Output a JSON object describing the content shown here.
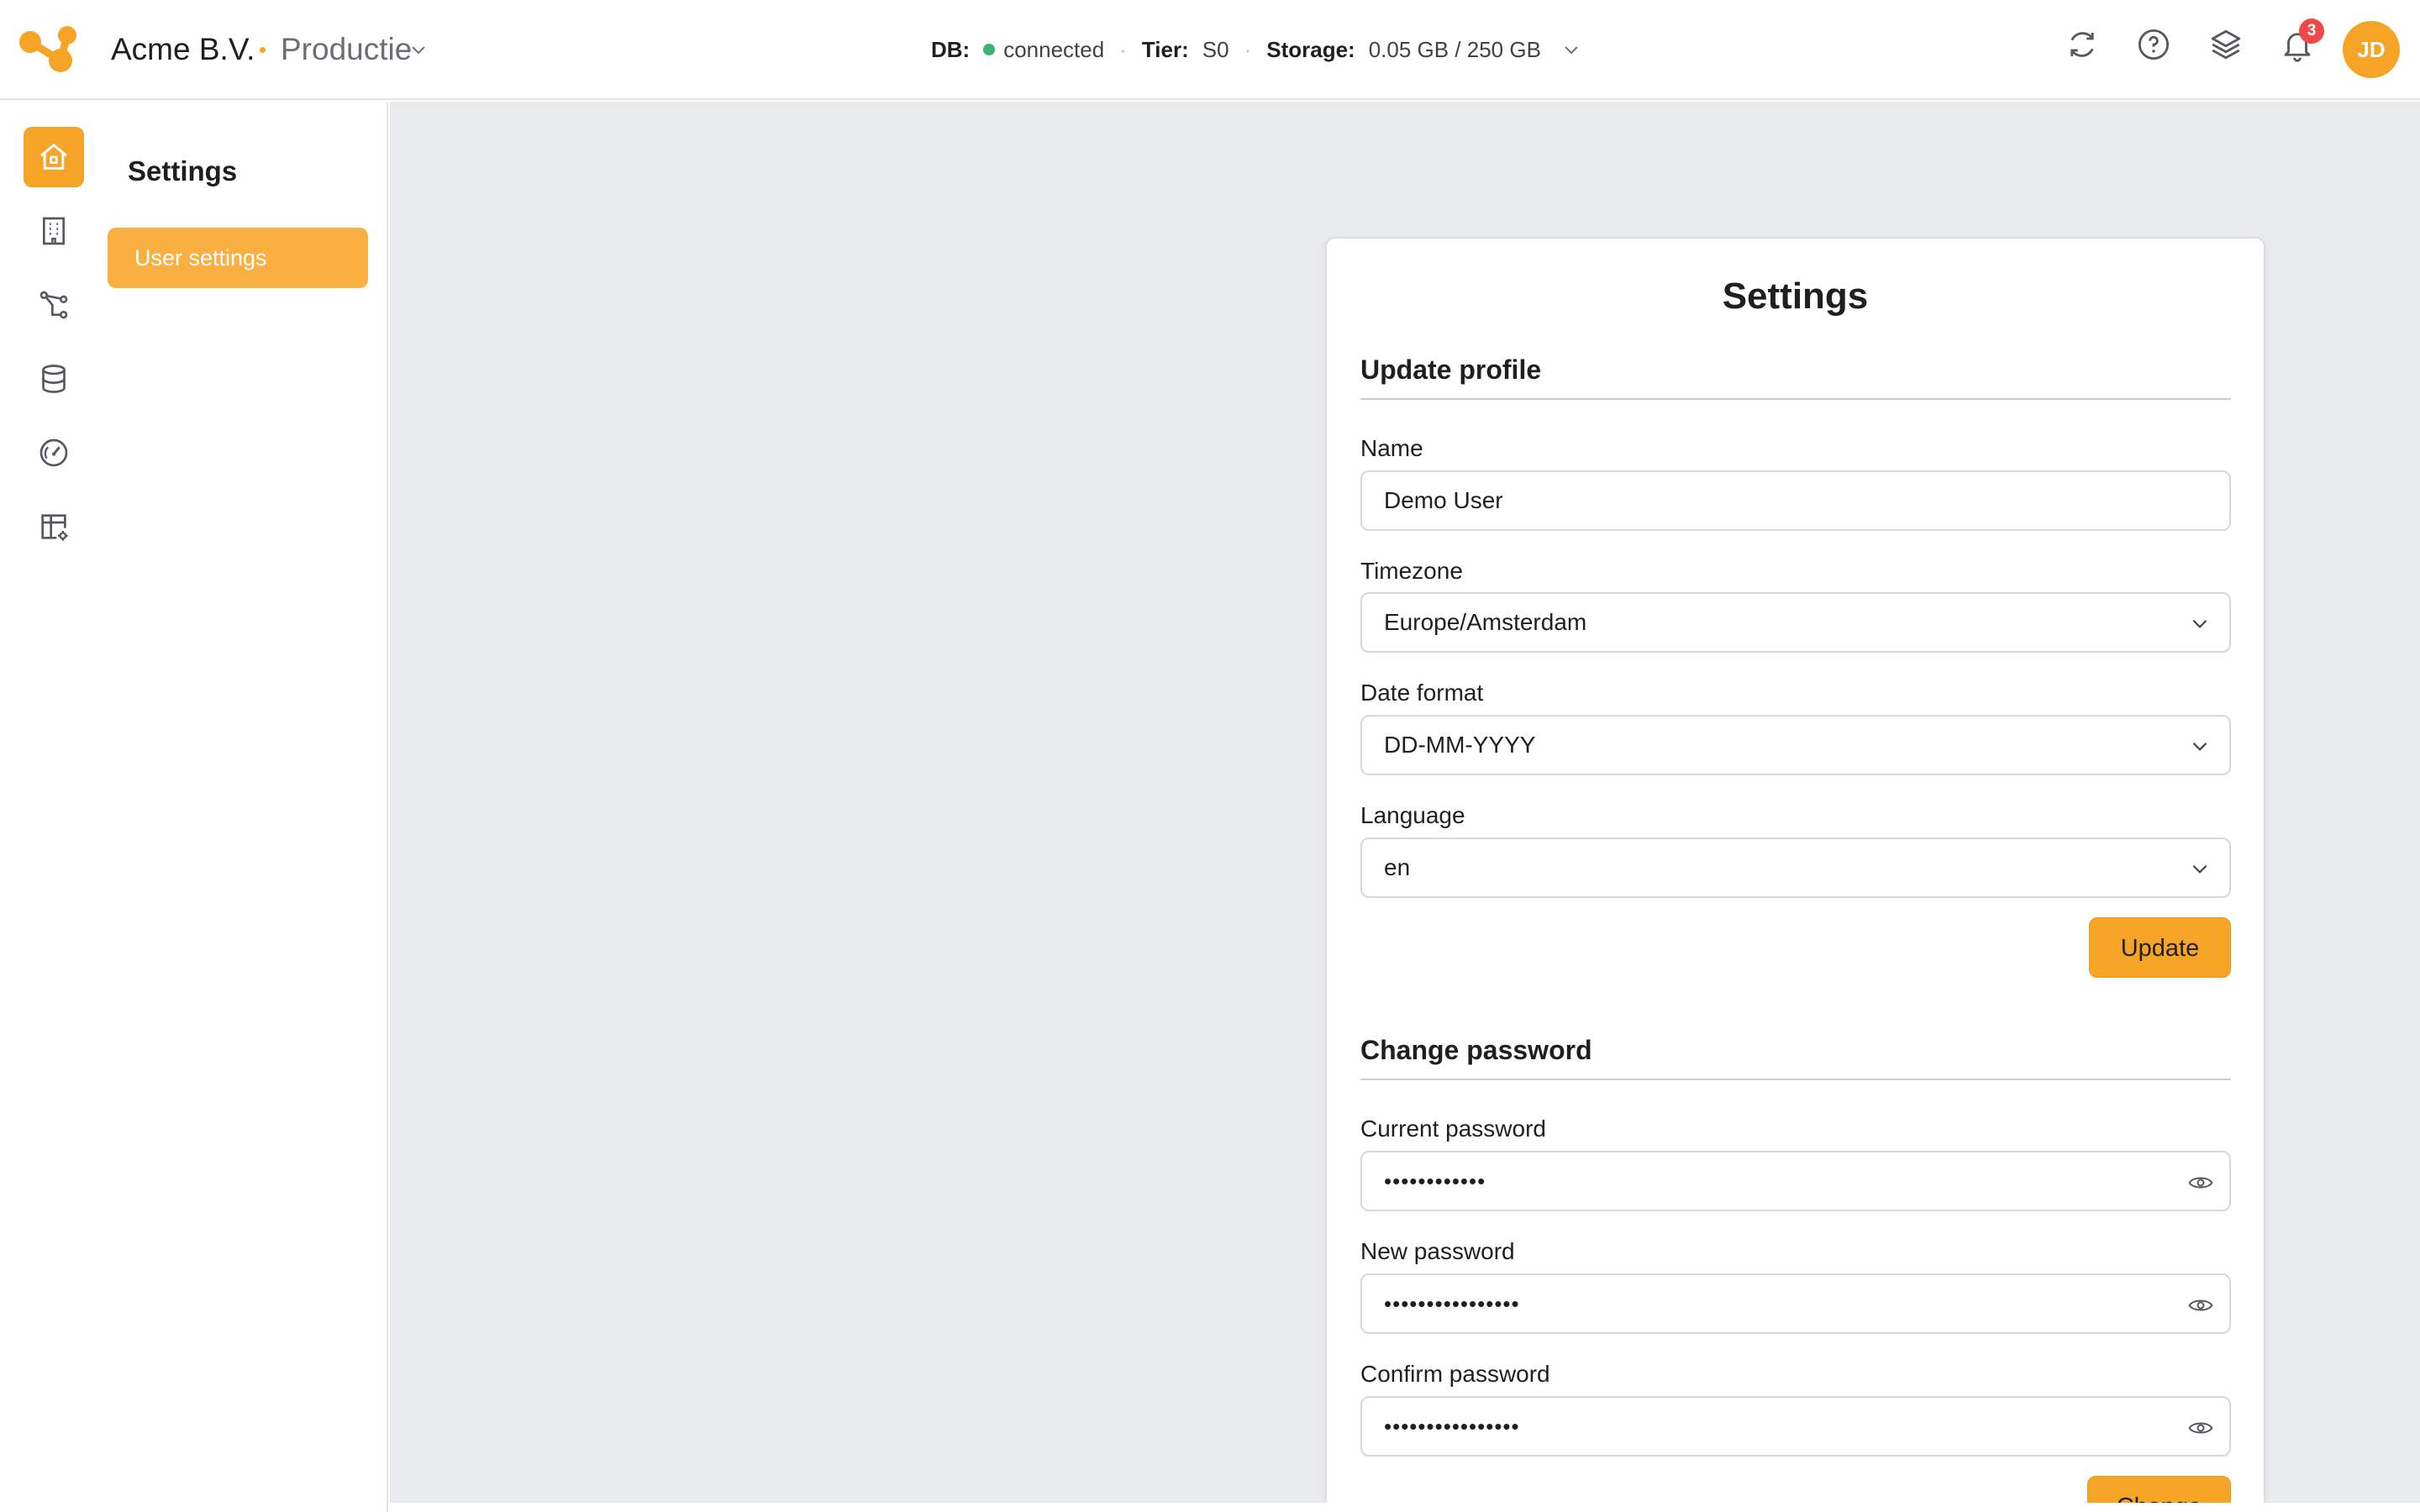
{
  "header": {
    "org_name": "Acme B.V.",
    "environment": "Productie",
    "status": {
      "db_label": "DB:",
      "db_value": "connected",
      "tier_label": "Tier:",
      "tier_value": "S0",
      "storage_label": "Storage:",
      "storage_value": "0.05 GB / 250 GB"
    },
    "icons": [
      "refresh-icon",
      "help-icon",
      "layers-icon",
      "bell-icon"
    ],
    "notification_count": "3",
    "avatar_initials": "JD",
    "colors": {
      "accent": "#f5a425",
      "connected": "#3cb371",
      "badge": "#ef4848"
    }
  },
  "rail": {
    "items": [
      {
        "name": "home-icon",
        "active": true
      },
      {
        "name": "building-icon",
        "active": false
      },
      {
        "name": "flow-icon",
        "active": false
      },
      {
        "name": "database-icon",
        "active": false
      },
      {
        "name": "gauge-icon",
        "active": false
      },
      {
        "name": "table-settings-icon",
        "active": false
      }
    ]
  },
  "subnav": {
    "title": "Settings",
    "items": [
      {
        "label": "User settings",
        "active": true
      }
    ]
  },
  "card": {
    "title": "Settings",
    "profile": {
      "heading": "Update profile",
      "name_label": "Name",
      "name_value": "Demo User",
      "timezone_label": "Timezone",
      "timezone_value": "Europe/Amsterdam",
      "date_format_label": "Date format",
      "date_format_value": "DD-MM-YYYY",
      "language_label": "Language",
      "language_value": "en",
      "submit_label": "Update"
    },
    "password": {
      "heading": "Change password",
      "current_label": "Current password",
      "current_value": "••••••••••••",
      "new_label": "New password",
      "new_value": "••••••••••••••••",
      "confirm_label": "Confirm password",
      "confirm_value": "••••••••••••••••",
      "submit_label": "Change"
    }
  }
}
